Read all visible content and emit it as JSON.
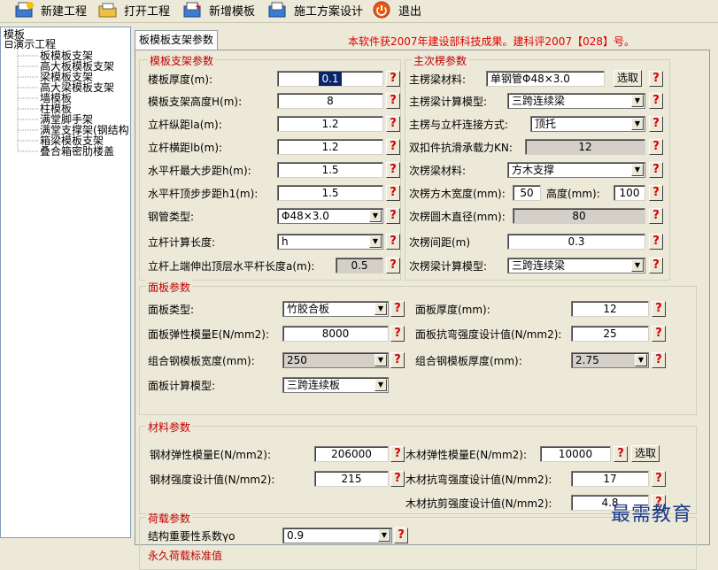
{
  "toolbar": {
    "buttons": [
      {
        "label": "新建工程",
        "icon": "new-project-icon"
      },
      {
        "label": "打开工程",
        "icon": "open-folder-icon"
      },
      {
        "label": "新增模板",
        "icon": "add-template-icon"
      },
      {
        "label": "施工方案设计",
        "icon": "plan-design-icon"
      },
      {
        "label": "退出",
        "icon": "exit-icon"
      }
    ]
  },
  "tree": {
    "root": "模板",
    "project": "演示工程",
    "items": [
      "板模板支架",
      "高大板模板支架",
      "梁模板支架",
      "高大梁模板支架",
      "墙模板",
      "柱模板",
      "满堂脚手架",
      "满堂支撑架(钢结构)",
      "箱梁模板支架",
      "叠合箱密肋楼盖"
    ]
  },
  "tab": {
    "label": "板模板支架参数"
  },
  "notice": "本软件获2007年建设部科技成果。建科评2007【028】号。",
  "support": {
    "title": "模板支架参数",
    "slab_thickness": {
      "label": "楼板厚度(m):",
      "value": "0.1"
    },
    "support_height": {
      "label": "模板支架高度H(m):",
      "value": "8"
    },
    "pole_long": {
      "label": "立杆纵距la(m):",
      "value": "1.2"
    },
    "pole_trans": {
      "label": "立杆横距lb(m):",
      "value": "1.2"
    },
    "step_max": {
      "label": "水平杆最大步距h(m):",
      "value": "1.5"
    },
    "step_top": {
      "label": "水平杆顶步步距h1(m):",
      "value": "1.5"
    },
    "pipe_type": {
      "label": "钢管类型:",
      "value": "Φ48×3.0"
    },
    "calc_length": {
      "label": "立杆计算长度:",
      "value": "h"
    },
    "extension": {
      "label": "立杆上端伸出顶层水平杆长度a(m):",
      "value": "0.5"
    }
  },
  "beam": {
    "title": "主次楞参数",
    "main_material": {
      "label": "主楞梁材料:",
      "value": "单钢管Φ48×3.0",
      "button": "选取"
    },
    "main_model": {
      "label": "主楞梁计算模型:",
      "value": "三跨连续梁"
    },
    "connection": {
      "label": "主楞与立杆连接方式:",
      "value": "顶托"
    },
    "fastener": {
      "label": "双扣件抗滑承载力KN:",
      "value": "12"
    },
    "sub_material": {
      "label": "次楞梁材料:",
      "value": "方木支撑"
    },
    "wood_width": {
      "label": "次楞方木宽度(mm):",
      "value": "50"
    },
    "wood_height": {
      "label": "高度(mm):",
      "value": "100"
    },
    "round_dia": {
      "label": "次楞圆木直径(mm):",
      "value": "80"
    },
    "spacing": {
      "label": "次楞间距(m)",
      "value": "0.3"
    },
    "sub_model": {
      "label": "次楞梁计算模型:",
      "value": "三跨连续梁"
    }
  },
  "panel": {
    "title": "面板参数",
    "type": {
      "label": "面板类型:",
      "value": "竹胶合板"
    },
    "thickness": {
      "label": "面板厚度(mm):",
      "value": "12"
    },
    "modulus": {
      "label": "面板弹性模量E(N/mm2):",
      "value": "8000"
    },
    "strength": {
      "label": "面板抗弯强度设计值(N/mm2):",
      "value": "25"
    },
    "steel_width": {
      "label": "组合钢模板宽度(mm):",
      "value": "250"
    },
    "steel_thickness": {
      "label": "组合钢模板厚度(mm):",
      "value": "2.75"
    },
    "model": {
      "label": "面板计算模型:",
      "value": "三跨连续板"
    }
  },
  "material": {
    "title": "材料参数",
    "steel_modulus": {
      "label": "钢材弹性模量E(N/mm2):",
      "value": "206000"
    },
    "wood_modulus": {
      "label": "木材弹性模量E(N/mm2):",
      "value": "10000"
    },
    "select_button": "选取",
    "steel_strength": {
      "label": "钢材强度设计值(N/mm2):",
      "value": "215"
    },
    "wood_bending": {
      "label": "木材抗弯强度设计值(N/mm2):",
      "value": "17"
    },
    "wood_shear": {
      "label": "木材抗剪强度设计值(N/mm2):",
      "value": "4.8"
    }
  },
  "load": {
    "title": "荷载参数",
    "importance": {
      "label": "结构重要性系数γo",
      "value": "0.9"
    },
    "permanent_title": "永久荷载标准值"
  },
  "help_glyph": "?",
  "dropdown_glyph": "▼",
  "watermark": "最需教育"
}
